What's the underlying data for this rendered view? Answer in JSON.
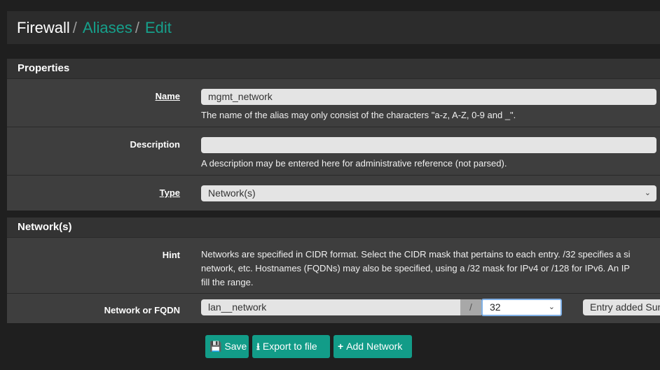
{
  "breadcrumb": {
    "root": "Firewall",
    "sep": "/",
    "aliases": "Aliases",
    "edit": "Edit"
  },
  "properties": {
    "heading": "Properties",
    "name": {
      "label": "Name",
      "value": "mgmt_network",
      "help": "The name of the alias may only consist of the characters \"a-z, A-Z, 0-9 and _\"."
    },
    "description": {
      "label": "Description",
      "value": "",
      "help": "A description may be entered here for administrative reference (not parsed)."
    },
    "type": {
      "label": "Type",
      "value": "Network(s)"
    }
  },
  "networks": {
    "heading": "Network(s)",
    "hint_label": "Hint",
    "hint_lines": [
      "Networks are specified in CIDR format. Select the CIDR mask that pertains to each entry. /32 specifies a si",
      "network, etc. Hostnames (FQDNs) may also be specified, using a /32 mask for IPv4 or /128 for IPv6. An IP",
      "fill the range."
    ],
    "entry_label": "Network or FQDN",
    "entry_value": "lan__network",
    "slash": "/",
    "mask": "32",
    "entry_description": "Entry added Sun,"
  },
  "buttons": {
    "save": "Save",
    "export": "Export to file",
    "add": "Add Network"
  },
  "colors": {
    "accent": "#16a08b"
  }
}
